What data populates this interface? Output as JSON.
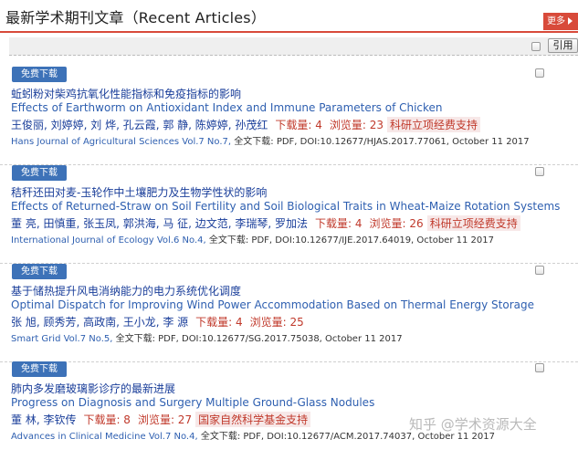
{
  "header": {
    "title": "最新学术期刊文章（Recent Articles）",
    "more_label": "更多"
  },
  "toolbar": {
    "cite_label": "引用"
  },
  "articles": [
    {
      "download_label": "免费下载",
      "title_cn": "蚯蚓粉对柴鸡抗氧化性能指标和免疫指标的影响",
      "title_en": "Effects of Earthworm on Antioxidant Index and Immune Parameters of Chicken",
      "authors": "王俊丽, 刘婷婷, 刘 烨, 孔云霞, 郭 静, 陈婷婷, 孙茂红",
      "downloads": "下载量: 4",
      "views": "浏览量: 23",
      "fund": "科研立项经费支持",
      "journal": "Hans Journal of Agricultural Sciences Vol.7 No.7,",
      "fulltext": " 全文下载: PDF, DOI:10.12677/HJAS.2017.77061, October 11 2017"
    },
    {
      "download_label": "免费下载",
      "title_cn": "秸秆还田对麦-玉轮作中土壤肥力及生物学性状的影响",
      "title_en": "Effects of Returned-Straw on Soil Fertility and Soil Biological Traits in Wheat-Maize Rotation Systems",
      "authors": "董 亮, 田慎重, 张玉凤, 郭洪海, 马 征, 边文范, 李瑞琴, 罗加法",
      "downloads": "下载量: 4",
      "views": "浏览量: 26",
      "fund": "科研立项经费支持",
      "journal": "International Journal of Ecology Vol.6 No.4,",
      "fulltext": " 全文下载: PDF, DOI:10.12677/IJE.2017.64019, October 11 2017"
    },
    {
      "download_label": "免费下载",
      "title_cn": "基于储热提升风电消纳能力的电力系统优化调度",
      "title_en": "Optimal Dispatch for Improving Wind Power Accommodation Based on Thermal Energy Storage",
      "authors": "张 旭, 顾秀芳, 高政南, 王小龙, 李 源",
      "downloads": "下载量: 4",
      "views": "浏览量: 25",
      "fund": "",
      "journal": "Smart Grid Vol.7 No.5,",
      "fulltext": " 全文下载: PDF, DOI:10.12677/SG.2017.75038, October 11 2017"
    },
    {
      "download_label": "免费下载",
      "title_cn": "肺内多发磨玻璃影诊疗的最新进展",
      "title_en": "Progress on Diagnosis and Surgery Multiple Ground-Glass Nodules",
      "authors": "董 林, 李钦传",
      "downloads": "下载量: 8",
      "views": "浏览量: 27",
      "fund": "国家自然科学基金支持",
      "journal": "Advances in Clinical Medicine Vol.7 No.4,",
      "fulltext": " 全文下载: PDF, DOI:10.12677/ACM.2017.74037, October 11 2017"
    }
  ],
  "watermark": "知乎 @学术资源大全"
}
